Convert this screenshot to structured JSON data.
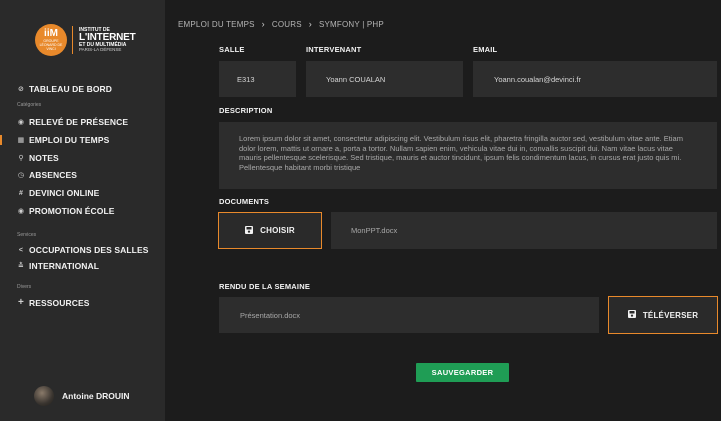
{
  "logo": {
    "badge_big": "iiM",
    "badge_small": "GROUPE LÉONARD DE VINCI",
    "line1": "INSTITUT DE",
    "line2": "L'INTERNET",
    "line3": "ET DU MULTIMÉDIA",
    "line4": "PARIS-LA DÉFENSE"
  },
  "sidebar": {
    "top_item": {
      "label": "TABLEAU DE BORD",
      "icon": "dashboard-icon"
    },
    "cat1": "Catégories",
    "cat1_items": [
      {
        "label": "RELEVÉ DE PRÉSENCE",
        "icon": "dot-icon"
      },
      {
        "label": "EMPLOI DU TEMPS",
        "icon": "calendar-icon"
      },
      {
        "label": "NOTES",
        "icon": "search-icon"
      },
      {
        "label": "ABSENCES",
        "icon": "clock-icon"
      },
      {
        "label": "DEVINCI ONLINE",
        "icon": "hash-icon"
      },
      {
        "label": "PROMOTION ÉCOLE",
        "icon": "dot-icon"
      }
    ],
    "cat2": "Services",
    "cat2_items": [
      {
        "label": "OCCUPATIONS DES SALLES",
        "icon": "share-icon"
      },
      {
        "label": "INTERNATIONAL",
        "icon": "plane-icon"
      }
    ],
    "cat3": "Divers",
    "cat3_items": [
      {
        "label": "RESSOURCES",
        "icon": "plus-icon"
      }
    ],
    "active_color": "#e8892b"
  },
  "user": {
    "name": "Antoine DROUIN"
  },
  "breadcrumb": [
    "EMPLOI DU TEMPS",
    "COURS",
    "SYMFONY | PHP"
  ],
  "form": {
    "salle_label": "SALLE",
    "salle_value": "E313",
    "intervenant_label": "INTERVENANT",
    "intervenant_value": "Yoann COUALAN",
    "email_label": "EMAIL",
    "email_value": "Yoann.coualan@devinci.fr",
    "description_label": "DESCRIPTION",
    "description_text": "Lorem ipsum dolor sit amet, consectetur adipiscing elit. Vestibulum risus elit, pharetra fringilla auctor sed, vestibulum vitae ante. Etiam dolor lorem, mattis ut ornare a, porta a tortor. Nullam sapien enim, vehicula vitae dui in, convallis suscipit dui. Nam vitae lacus vitae mauris pellentesque scelerisque. Sed tristique, mauris et auctor tincidunt, ipsum felis condimentum lacus, in cursus erat justo quis mi. Pellentesque habitant morbi tristique",
    "documents_label": "DOCUMENTS",
    "choose_button": "CHOISIR",
    "document_file": "MonPPT.docx",
    "rendu_label": "RENDU DE LA SEMAINE",
    "rendu_file": "Présentation.docx",
    "upload_button": "TÉLÉVERSER",
    "save_button": "SAUVEGARDER"
  },
  "colors": {
    "accent": "#e8892b",
    "save": "#1f9d55"
  }
}
